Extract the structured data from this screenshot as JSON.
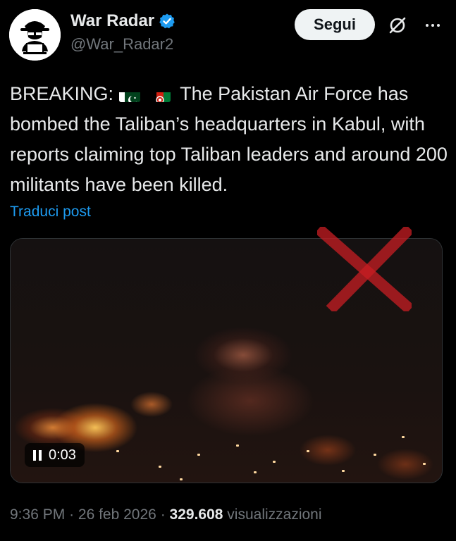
{
  "author": {
    "display_name": "War Radar",
    "handle": "@War_Radar2",
    "avatar_icon": "hacker-avatar-icon",
    "verified_icon": "verified-badge-icon",
    "verified_color": "#1d9bf0"
  },
  "actions": {
    "follow_label": "Segui",
    "grok_icon": "grok-icon",
    "more_icon": "more-options-icon"
  },
  "tweet": {
    "prefix": "BREAKING:",
    "flags": [
      "pakistan-flag-icon",
      "afghanistan-flag-icon"
    ],
    "body": "The Pakistan Air Force has bombed the Taliban’s headquarters in Kabul, with reports claiming top Taliban leaders and around 200 militants have been killed.",
    "translate_label": "Traduci post",
    "link_color": "#1d9bf0"
  },
  "media": {
    "type": "video",
    "elapsed": "0:03",
    "state_icon": "pause-icon",
    "overlay_icon": "red-x-mark-icon"
  },
  "meta": {
    "time": "9:36 PM",
    "separator": "·",
    "date": "26 feb 2026",
    "views_count": "329.608",
    "views_label": "visualizzazioni"
  }
}
